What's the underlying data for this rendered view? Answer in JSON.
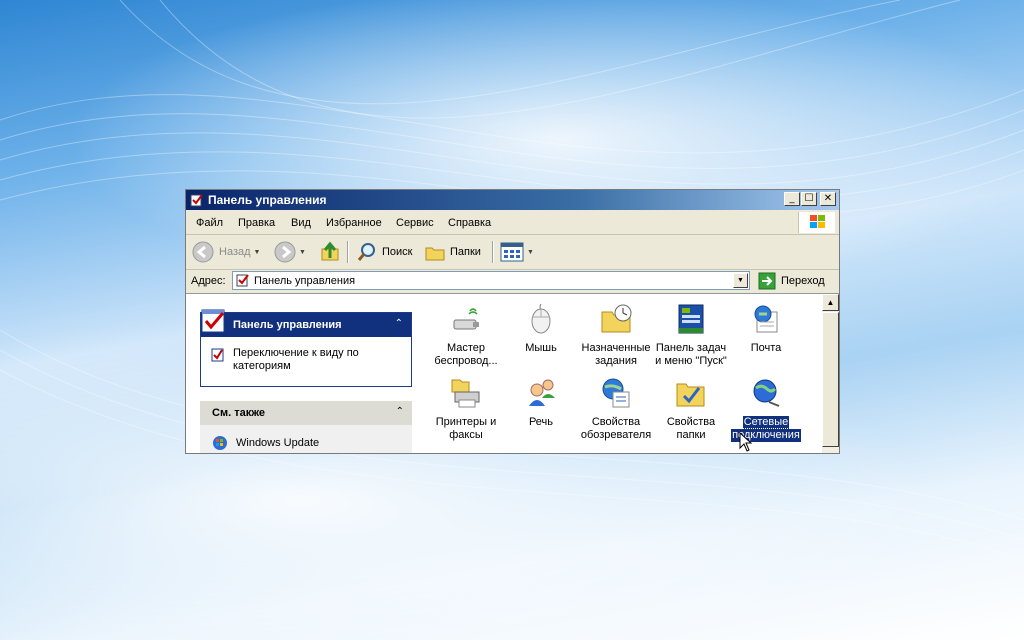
{
  "window": {
    "title": "Панель управления",
    "caption_buttons": {
      "minimize": "_",
      "maximize": "☐",
      "close": "✕"
    }
  },
  "menu": [
    "Файл",
    "Правка",
    "Вид",
    "Избранное",
    "Сервис",
    "Справка"
  ],
  "toolbar": {
    "back_label": "Назад",
    "search_label": "Поиск",
    "folders_label": "Папки"
  },
  "address": {
    "label": "Адрес:",
    "value": "Панель управления",
    "go_label": "Переход"
  },
  "left_pane": {
    "control_panel": {
      "title": "Панель управления",
      "switch_link": "Переключение к виду по категориям"
    },
    "see_also": {
      "title": "См. также",
      "links": [
        "Windows Update"
      ]
    }
  },
  "items": [
    {
      "line1": "Мастер",
      "line2": "беспровод...",
      "icon": "wireless-wizard-icon"
    },
    {
      "line1": "Мышь",
      "line2": "",
      "icon": "mouse-icon"
    },
    {
      "line1": "Назначенные",
      "line2": "задания",
      "icon": "scheduled-tasks-icon"
    },
    {
      "line1": "Панель задач",
      "line2": "и меню \"Пуск\"",
      "icon": "taskbar-icon"
    },
    {
      "line1": "Почта",
      "line2": "",
      "icon": "mail-icon"
    },
    {
      "line1": "Принтеры и",
      "line2": "факсы",
      "icon": "printer-icon"
    },
    {
      "line1": "Речь",
      "line2": "",
      "icon": "speech-icon"
    },
    {
      "line1": "Свойства",
      "line2": "обозревателя",
      "icon": "internet-options-icon"
    },
    {
      "line1": "Свойства",
      "line2": "папки",
      "icon": "folder-options-icon"
    },
    {
      "line1": "Сетевые",
      "line2": "подключения",
      "icon": "network-connections-icon",
      "selected": true
    }
  ],
  "colors": {
    "title_bar": "#0a246a",
    "panel_header": "#11317e",
    "selection": "#11317e",
    "window_bg": "#ece9d8"
  }
}
